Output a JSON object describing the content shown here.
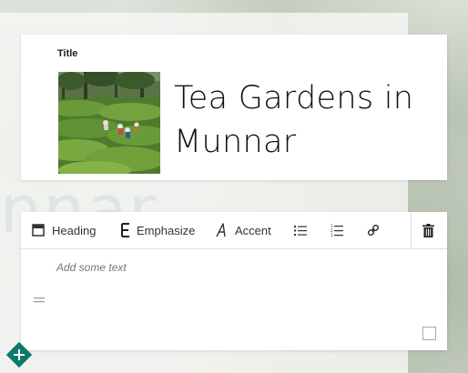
{
  "title_card": {
    "label": "Title",
    "heading": "Tea Gardens in Munnar",
    "image_icon": "tea-plantation-photo"
  },
  "toolbar": {
    "heading_label": "Heading",
    "emphasize_label": "Emphasize",
    "accent_label": "Accent",
    "heading_icon": "heading-icon",
    "emphasize_icon": "emphasize-icon",
    "accent_icon": "accent-icon",
    "bullet_list_icon": "bullet-list-icon",
    "numbered_list_icon": "numbered-list-icon",
    "link_icon": "link-icon",
    "delete_icon": "trash-icon"
  },
  "text_card": {
    "placeholder": "Add some text"
  },
  "colors": {
    "accent": "#0b7a69"
  }
}
